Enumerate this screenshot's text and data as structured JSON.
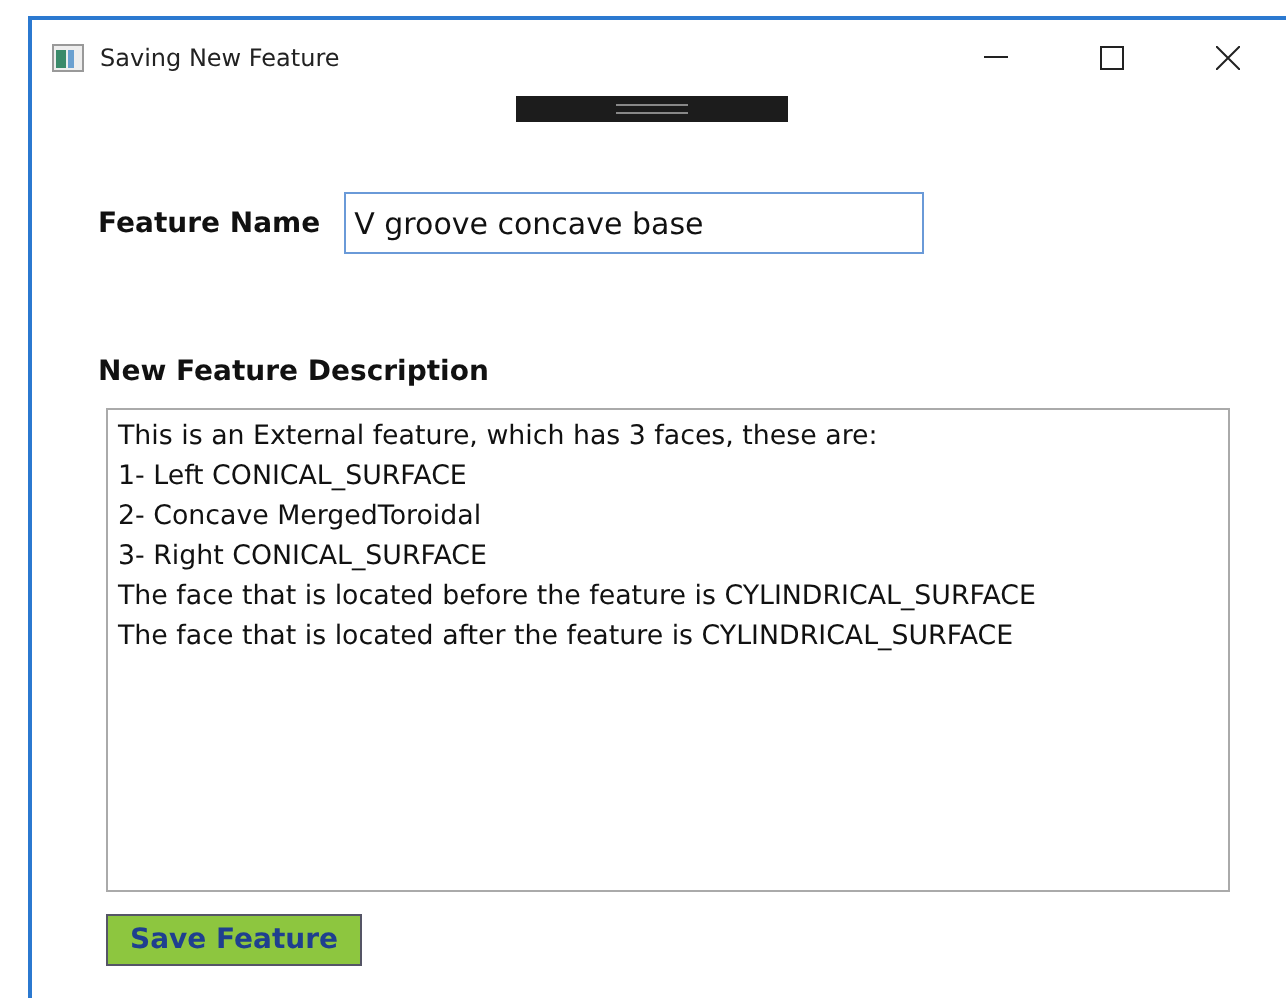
{
  "window": {
    "title": "Saving New Feature"
  },
  "feature_name": {
    "label": "Feature Name",
    "value": "V groove concave base"
  },
  "description": {
    "label": "New Feature Description",
    "lines": [
      "This is an External feature, which has 3 faces, these are:",
      "1- Left CONICAL_SURFACE",
      "2- Concave MergedToroidal",
      "3- Right CONICAL_SURFACE",
      "The face that is located before the feature is CYLINDRICAL_SURFACE",
      "The face that is located after the feature is CYLINDRICAL_SURFACE"
    ]
  },
  "buttons": [
    {
      "label": "Save Feature"
    }
  ]
}
